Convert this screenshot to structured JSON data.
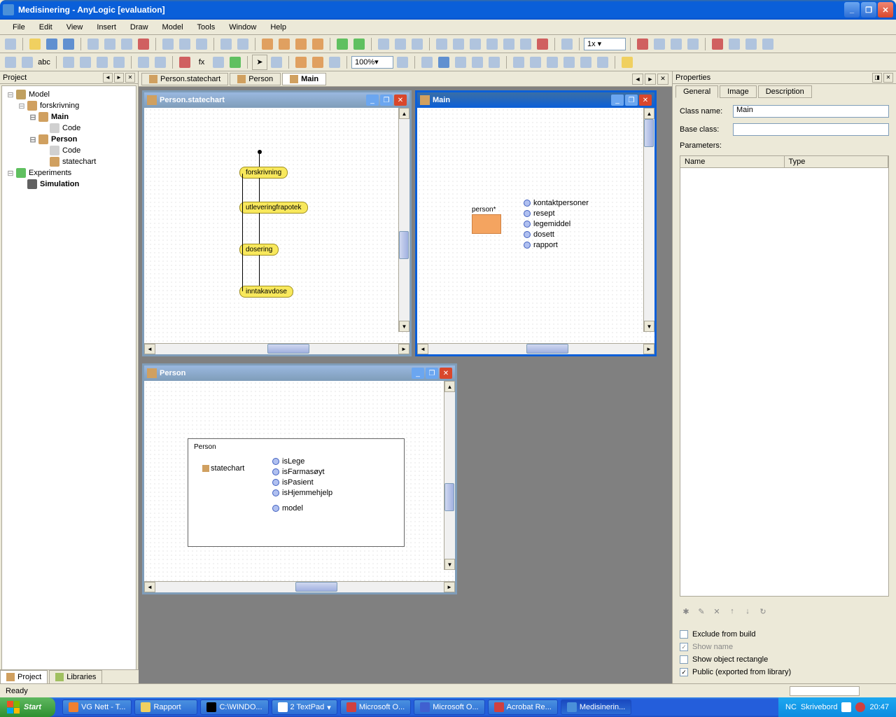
{
  "window": {
    "title": "Medisinering - AnyLogic [evaluation]"
  },
  "menu": [
    "File",
    "Edit",
    "View",
    "Insert",
    "Draw",
    "Model",
    "Tools",
    "Window",
    "Help"
  ],
  "toolbar": {
    "zoom": "100%"
  },
  "project": {
    "panel_title": "Project",
    "tabs": [
      "Project",
      "Libraries"
    ],
    "tree": {
      "root": "Model",
      "items": [
        {
          "label": "forskrivning",
          "level": 1
        },
        {
          "label": "Main",
          "level": 2,
          "bold": true
        },
        {
          "label": "Code",
          "level": 3,
          "icon": "code"
        },
        {
          "label": "Person",
          "level": 2,
          "bold": true
        },
        {
          "label": "Code",
          "level": 3,
          "icon": "code"
        },
        {
          "label": "statechart",
          "level": 3,
          "icon": "state"
        },
        {
          "label": "Experiments",
          "level": 1
        },
        {
          "label": "Simulation",
          "level": 2,
          "bold": true,
          "icon": "sim"
        }
      ]
    }
  },
  "editor_tabs": [
    "Person.statechart",
    "Person",
    "Main"
  ],
  "active_editor_tab": "Main",
  "mdi": {
    "statechart": {
      "title": "Person.statechart",
      "states": [
        "forskrivning",
        "utleveringfrapotek",
        "dosering",
        "inntakavdose"
      ]
    },
    "main": {
      "title": "Main",
      "agent_label": "person*",
      "params": [
        "kontaktpersoner",
        "resept",
        "legemiddel",
        "dosett",
        "rapport"
      ]
    },
    "person": {
      "title": "Person",
      "class_label": "Person",
      "statechart_label": "statechart",
      "params": [
        "isLege",
        "isFarmasøyt",
        "isPasient",
        "isHjemmehjelp"
      ],
      "model_param": "model"
    }
  },
  "properties": {
    "panel_title": "Properties",
    "tabs": [
      "General",
      "Image",
      "Description"
    ],
    "active_tab": "General",
    "class_name_label": "Class name:",
    "class_name_value": "Main",
    "base_class_label": "Base class:",
    "base_class_value": "",
    "parameters_label": "Parameters:",
    "table_headers": [
      "Name",
      "Type"
    ],
    "checks": {
      "exclude": "Exclude from build",
      "show_name": "Show name",
      "show_rect": "Show object rectangle",
      "public": "Public (exported from library)"
    }
  },
  "statusbar": {
    "text": "Ready"
  },
  "taskbar": {
    "start": "Start",
    "items": [
      "VG Nett - T...",
      "Rapport",
      "C:\\WINDO...",
      "2 TextPad",
      "Microsoft O...",
      "Microsoft O...",
      "Acrobat Re...",
      "Medisinerin..."
    ],
    "tray": {
      "nc": "NC",
      "skr": "Skrivebord",
      "time": "20:47"
    }
  }
}
